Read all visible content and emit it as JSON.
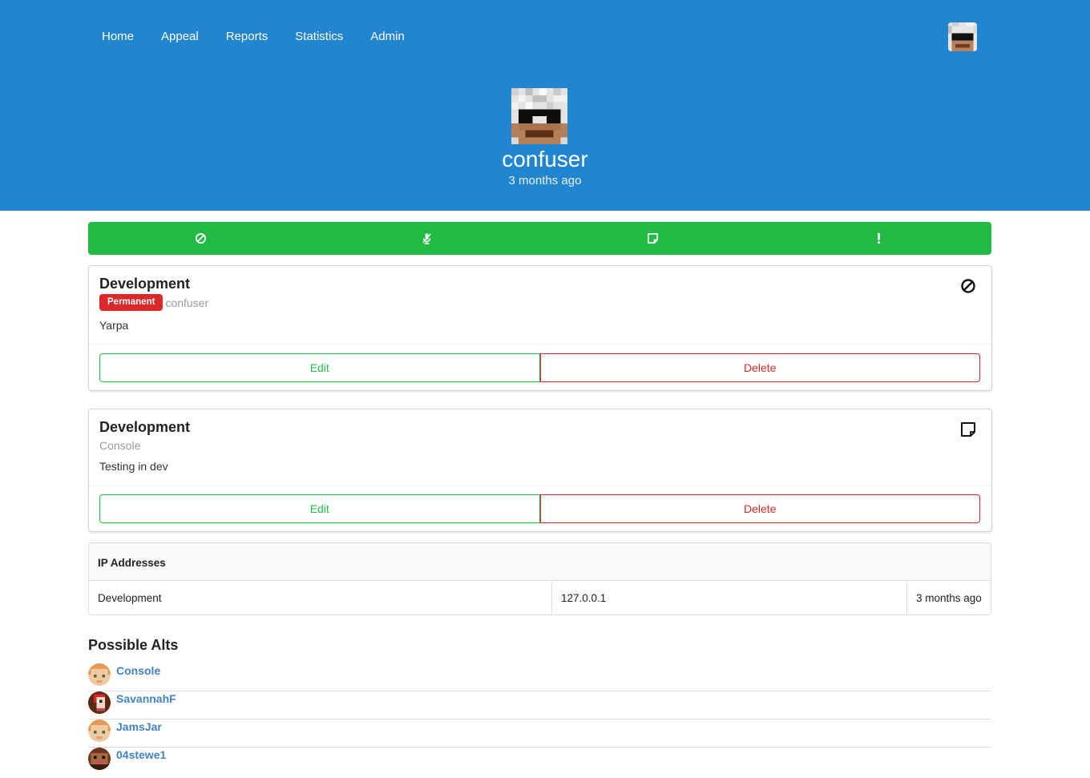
{
  "nav": {
    "items": [
      {
        "label": "Home"
      },
      {
        "label": "Appeal"
      },
      {
        "label": "Reports"
      },
      {
        "label": "Statistics"
      },
      {
        "label": "Admin"
      }
    ],
    "avatar_icon": "player-head-icon"
  },
  "profile": {
    "name": "confuser",
    "joined": "3 months ago"
  },
  "action_bar": {
    "color": "#21ba45",
    "icons": [
      "ban-icon",
      "mute-icon",
      "note-icon",
      "warning-icon"
    ]
  },
  "punishments": [
    {
      "server": "Development",
      "badge": "Permanent",
      "actor": "confuser",
      "reason": "Yarpa",
      "type_icon": "ban-icon",
      "edit_label": "Edit",
      "delete_label": "Delete"
    },
    {
      "server": "Development",
      "actor": "Console",
      "reason": "Testing in dev",
      "type_icon": "note-icon",
      "edit_label": "Edit",
      "delete_label": "Delete"
    }
  ],
  "ip_addresses": {
    "header": "IP Addresses",
    "rows": [
      {
        "server": "Development",
        "ip": "127.0.0.1",
        "time": "3 months ago"
      }
    ]
  },
  "alts": {
    "title": "Possible Alts",
    "items": [
      {
        "name": "Console"
      },
      {
        "name": "SavannahF"
      },
      {
        "name": "JamsJar"
      },
      {
        "name": "04stewe1"
      }
    ]
  },
  "colors": {
    "primary": "#2185d0",
    "positive": "#21ba45",
    "negative": "#db2828",
    "link": "#4183c4"
  }
}
